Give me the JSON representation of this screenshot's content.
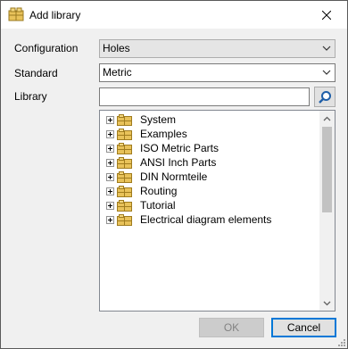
{
  "window": {
    "title": "Add library",
    "title_icon": "library-books-icon",
    "close_icon": "close-icon"
  },
  "form": {
    "configuration_label": "Configuration",
    "configuration_value": "Holes",
    "standard_label": "Standard",
    "standard_value": "Metric",
    "library_label": "Library",
    "library_value": "",
    "search_icon": "search-icon"
  },
  "tree": {
    "items": [
      {
        "label": "System"
      },
      {
        "label": "Examples"
      },
      {
        "label": "ISO Metric Parts"
      },
      {
        "label": "ANSI Inch Parts"
      },
      {
        "label": "DIN Normteile"
      },
      {
        "label": "Routing"
      },
      {
        "label": "Tutorial"
      },
      {
        "label": "Electrical diagram elements"
      }
    ]
  },
  "buttons": {
    "ok_label": "OK",
    "cancel_label": "Cancel"
  },
  "colors": {
    "accent": "#0078d7",
    "folder": "#e8c25a"
  }
}
